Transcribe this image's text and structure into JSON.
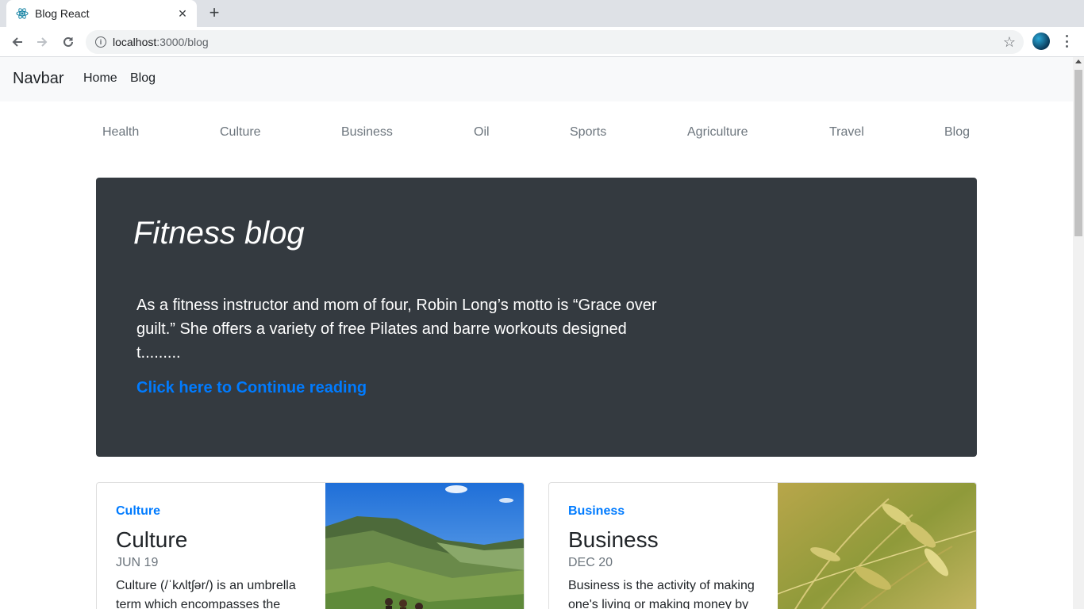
{
  "browser": {
    "tab_title": "Blog React",
    "url_host": "localhost",
    "url_rest": ":3000/blog",
    "new_tab_glyph": "+",
    "close_glyph": "✕"
  },
  "navbar": {
    "brand": "Navbar",
    "links": [
      "Home",
      "Blog"
    ]
  },
  "categories": [
    "Health",
    "Culture",
    "Business",
    "Oil",
    "Sports",
    "Agriculture",
    "Travel",
    "Blog"
  ],
  "featured": {
    "title": "Fitness blog",
    "excerpt": "As a fitness instructor and mom of four, Robin Long’s motto is “Grace over guilt.” She offers a variety of free Pilates and barre workouts designed t.........",
    "link": "Click here to Continue reading"
  },
  "cards": [
    {
      "category": "Culture",
      "title": "Culture",
      "date": "JUN 19",
      "excerpt": "Culture (/ˈkʌltʃər/) is an umbrella term which encompasses the",
      "image": "mountain-valley-photo"
    },
    {
      "category": "Business",
      "title": "Business",
      "date": "DEC 20",
      "excerpt": "Business is the activity of making one's living or making money by",
      "image": "wheat-field-photo"
    }
  ],
  "colors": {
    "accent": "#007bff",
    "jumbotron_bg": "#343a40",
    "navbar_bg": "#f8f9fa",
    "muted": "#6c757d"
  }
}
